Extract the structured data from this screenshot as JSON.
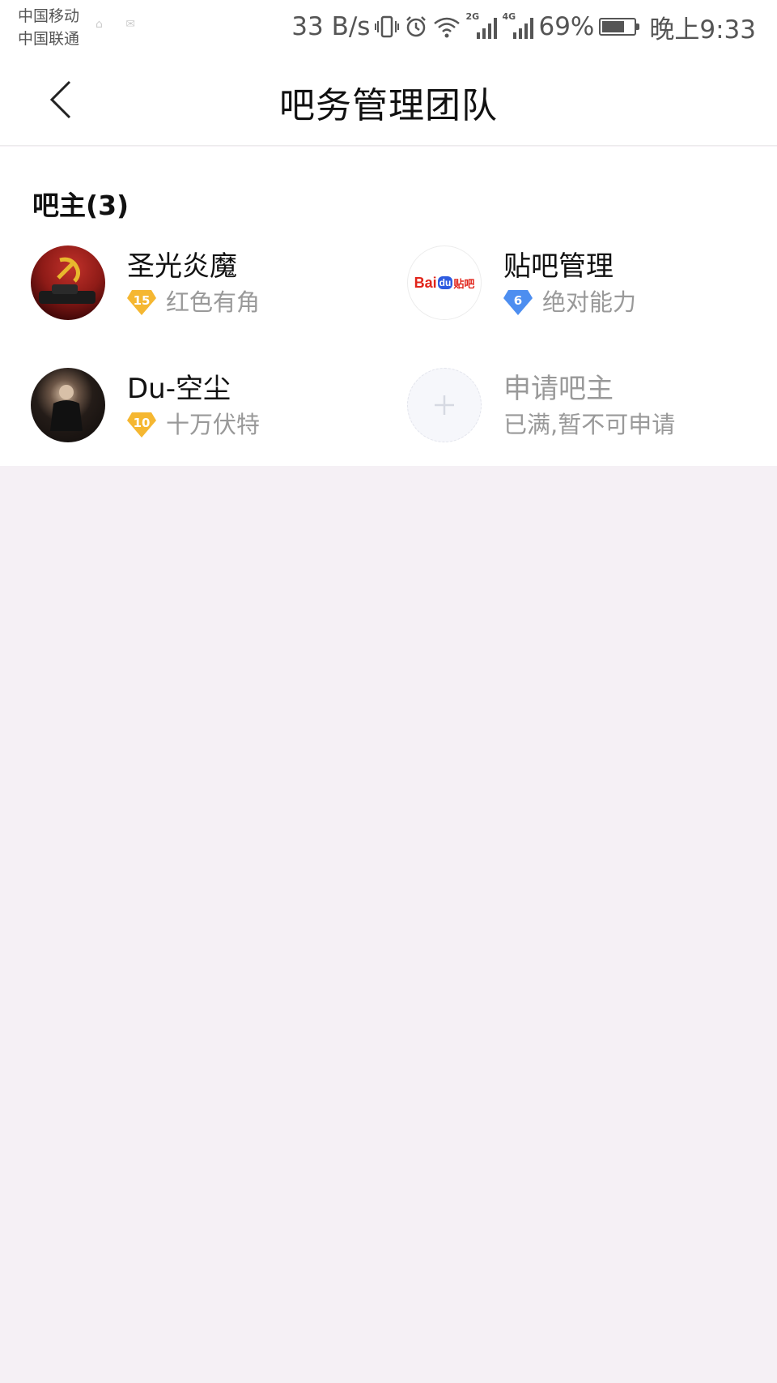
{
  "status_bar": {
    "carrier_1": "中国移动",
    "carrier_2": "中国联通",
    "speed": "33 B/s",
    "signal_1_tag": "2G",
    "signal_2_tag": "4G",
    "battery": "69%",
    "time": "晚上9:33",
    "icons": [
      "vibrate-icon",
      "alarm-icon",
      "wifi-icon",
      "signal-icon",
      "battery-icon"
    ]
  },
  "header": {
    "title": "吧务管理团队"
  },
  "section": {
    "title": "吧主(3)"
  },
  "members": [
    {
      "name": "圣光炎魔",
      "level": "15",
      "title": "红色有角",
      "badge_color": "#f5b731"
    },
    {
      "name": "贴吧管理",
      "level": "6",
      "title": "绝对能力",
      "badge_color": "#4d8ef0"
    },
    {
      "name": "Du-空尘",
      "level": "10",
      "title": "十万伏特",
      "badge_color": "#f5b731"
    }
  ],
  "apply": {
    "name": "申请吧主",
    "status": "已满,暂不可申请"
  },
  "logo_text": {
    "bai": "Bai",
    "du": "du",
    "tieba": "贴吧"
  }
}
